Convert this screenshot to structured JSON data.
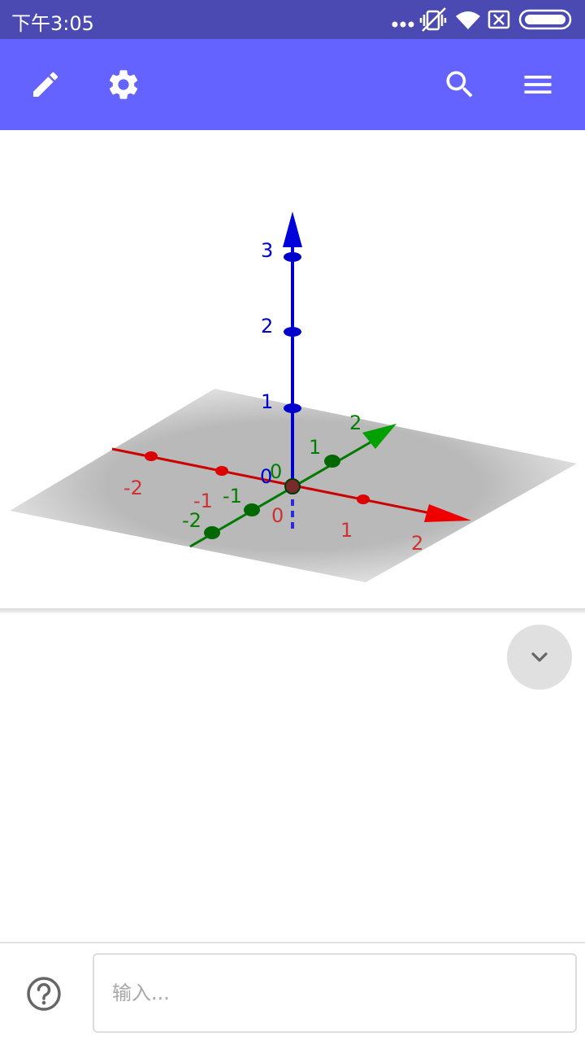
{
  "status_bar": {
    "time": "下午3:05",
    "icons": [
      "more-dots-icon",
      "vibrate-off-icon",
      "wifi-icon",
      "sim-x-icon",
      "battery-icon"
    ]
  },
  "toolbar": {
    "buttons": [
      "pencil-icon",
      "gear-icon",
      "search-icon",
      "menu-icon"
    ],
    "color": "#6563ff"
  },
  "graphics_3d": {
    "x_axis": {
      "color": "#cc0000",
      "tick_labels": [
        "-2",
        "-1",
        "0",
        "1",
        "2"
      ]
    },
    "y_axis": {
      "color": "#007a00",
      "tick_labels": [
        "-2",
        "-1",
        "0",
        "1",
        "2"
      ]
    },
    "z_axis": {
      "color": "#0000cc",
      "tick_labels": [
        "0",
        "1",
        "2",
        "3"
      ]
    }
  },
  "algebra_view": {
    "collapse_icon": "chevron-down-icon"
  },
  "input_bar": {
    "placeholder": "输入...",
    "help_icon": "help-circle-icon"
  }
}
